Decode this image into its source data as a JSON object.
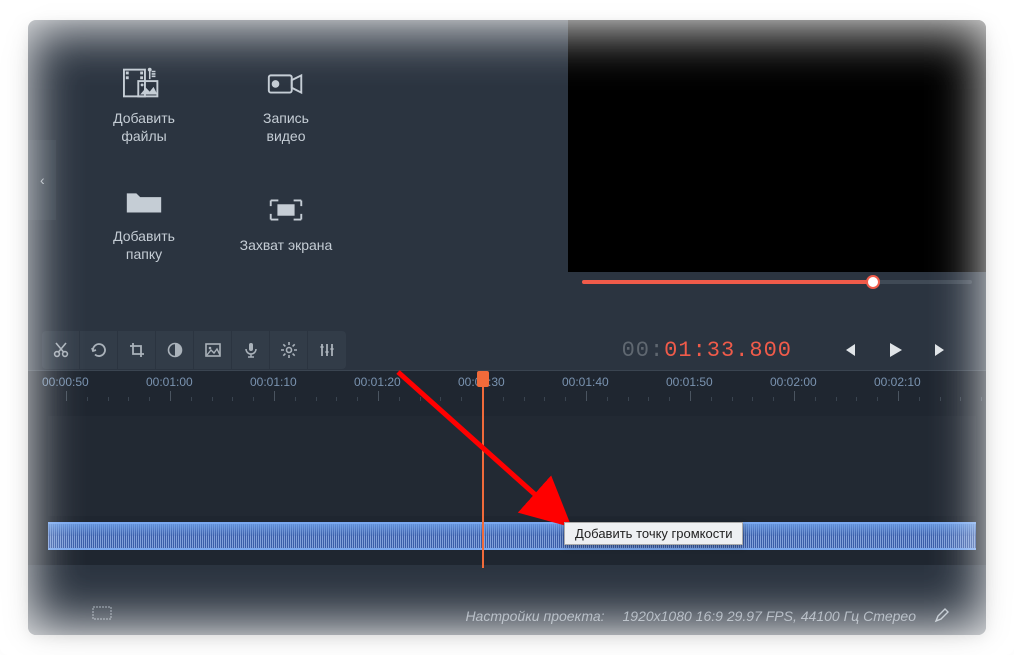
{
  "media_buttons": {
    "add_files": "Добавить\nфайлы",
    "record_video": "Запись\nвидео",
    "add_folder": "Добавить\nпапку",
    "screen_capture": "Захват экрана"
  },
  "timecode": {
    "hh": "00:",
    "rest": "01:33.800"
  },
  "ruler": {
    "labels": [
      "00:00:50",
      "00:01:00",
      "00:01:10",
      "00:01:20",
      "00:01:30",
      "00:01:40",
      "00:01:50",
      "00:02:00",
      "00:02:10"
    ]
  },
  "context_menu": {
    "add_volume_point": "Добавить точку громкости"
  },
  "status": {
    "settings_label": "Настройки проекта:",
    "resolution": "1920x1080 16:9 29.97 FPS, 44100 Гц Стерео"
  },
  "icons": {
    "cut": "✂",
    "rotate": "↻",
    "crop": "◫",
    "contrast": "◐",
    "picture": "▱",
    "mic": "●",
    "gear": "⚙",
    "sliders": "┇┇┇",
    "prev": "⏮",
    "play": "▶",
    "next": "⏭",
    "pencil": "✎",
    "film": "▭",
    "chevron_left": "‹"
  }
}
